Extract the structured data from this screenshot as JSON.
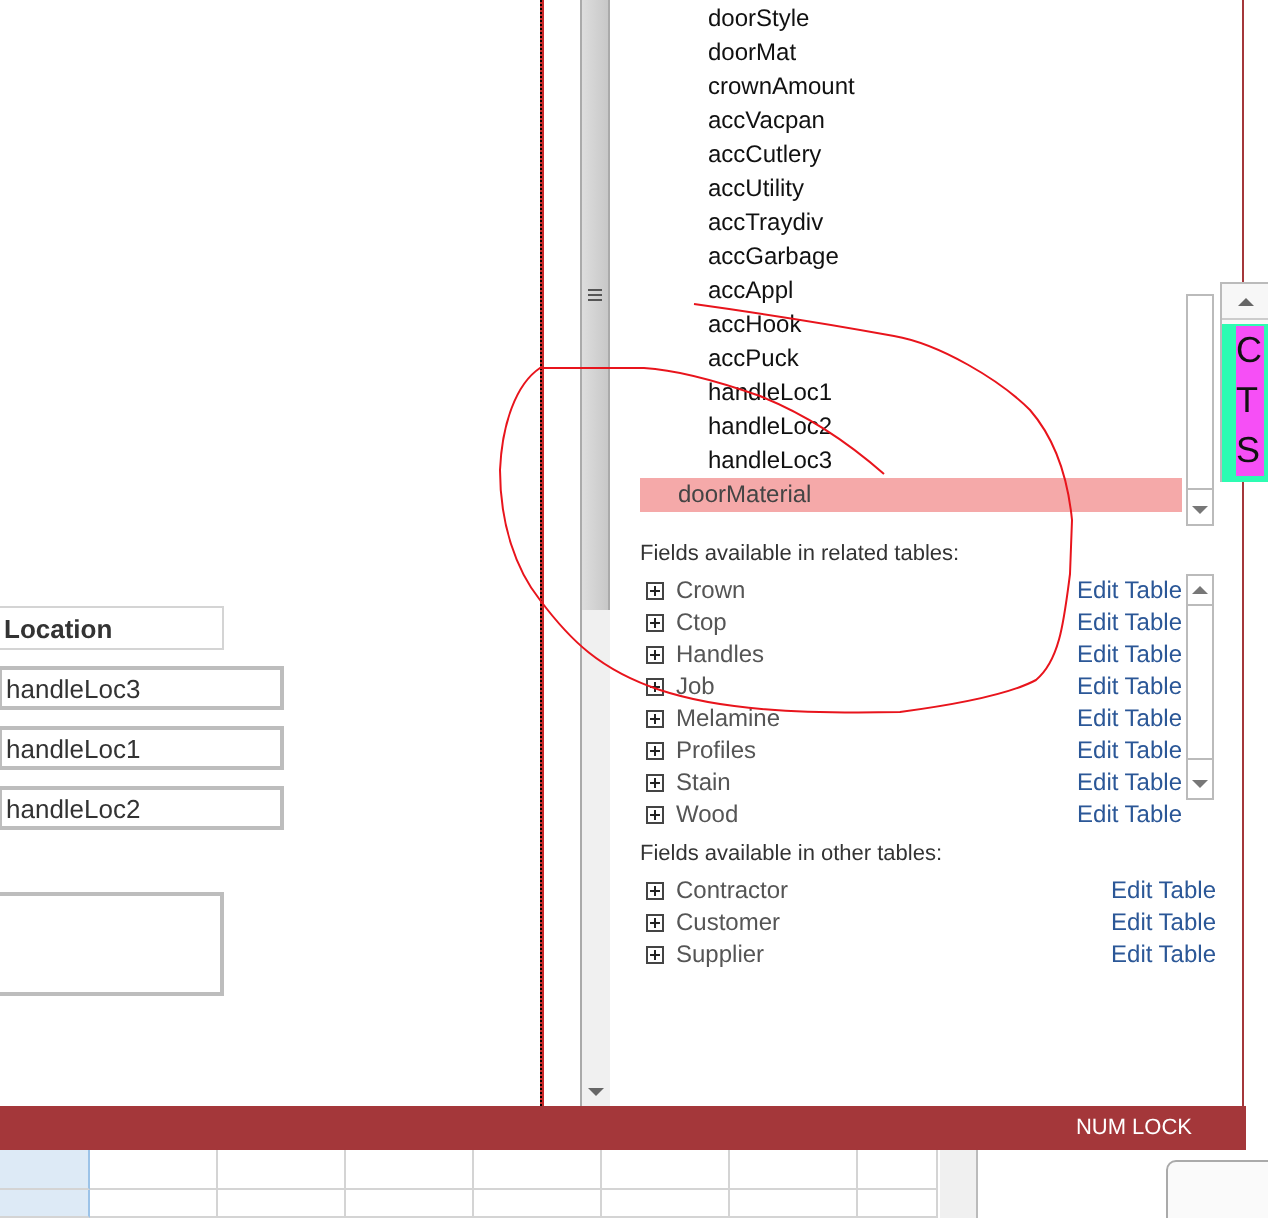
{
  "form": {
    "location_label": "Location",
    "text_boxes": [
      "handleLoc3",
      "handleLoc1",
      "handleLoc2"
    ]
  },
  "field_list": {
    "fields": [
      {
        "label": "doorStyle",
        "selected": false
      },
      {
        "label": "doorMat",
        "selected": false
      },
      {
        "label": "crownAmount",
        "selected": false
      },
      {
        "label": "accVacpan",
        "selected": false
      },
      {
        "label": "accCutlery",
        "selected": false
      },
      {
        "label": "accUtility",
        "selected": false
      },
      {
        "label": "accTraydiv",
        "selected": false
      },
      {
        "label": "accGarbage",
        "selected": false
      },
      {
        "label": "accAppl",
        "selected": false
      },
      {
        "label": "accHook",
        "selected": false
      },
      {
        "label": "accPuck",
        "selected": false
      },
      {
        "label": "handleLoc1",
        "selected": false
      },
      {
        "label": "handleLoc2",
        "selected": false
      },
      {
        "label": "handleLoc3",
        "selected": false
      },
      {
        "label": "doorMaterial",
        "selected": true
      }
    ],
    "related_heading": "Fields available in related tables:",
    "related_tables": [
      {
        "name": "Crown",
        "link": "Edit Table"
      },
      {
        "name": "Ctop",
        "link": "Edit Table"
      },
      {
        "name": "Handles",
        "link": "Edit Table"
      },
      {
        "name": "Job",
        "link": "Edit Table"
      },
      {
        "name": "Melamine",
        "link": "Edit Table"
      },
      {
        "name": "Profiles",
        "link": "Edit Table"
      },
      {
        "name": "Stain",
        "link": "Edit Table"
      },
      {
        "name": "Wood",
        "link": "Edit Table"
      }
    ],
    "other_heading": "Fields available in other tables:",
    "other_tables": [
      {
        "name": "Contractor",
        "link": "Edit Table"
      },
      {
        "name": "Customer",
        "link": "Edit Table"
      },
      {
        "name": "Supplier",
        "link": "Edit Table"
      }
    ]
  },
  "side_widget": {
    "letters": [
      "C",
      "T",
      "S"
    ]
  },
  "status_bar": {
    "indicator": "NUM LOCK"
  }
}
